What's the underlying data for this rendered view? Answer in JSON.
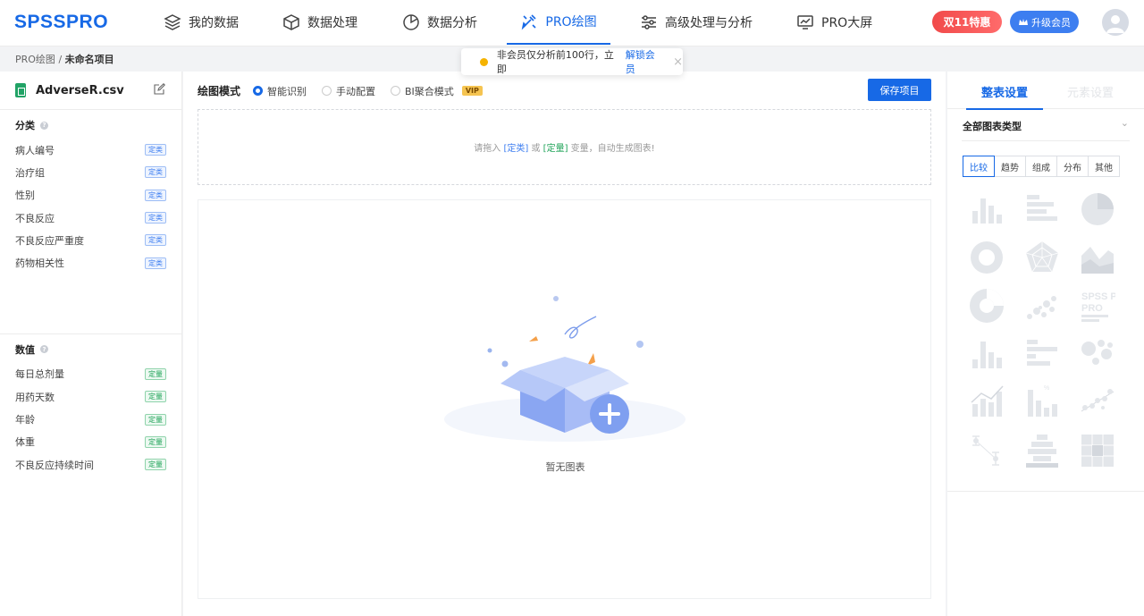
{
  "brand": {
    "logo": "SPSSPRO"
  },
  "nav": [
    {
      "label": "我的数据",
      "icon": "layers-icon",
      "active": false
    },
    {
      "label": "数据处理",
      "icon": "cube-icon",
      "active": false
    },
    {
      "label": "数据分析",
      "icon": "pie-icon",
      "active": false
    },
    {
      "label": "PRO绘图",
      "icon": "paint-icon",
      "active": true
    },
    {
      "label": "高级处理与分析",
      "icon": "sliders-icon",
      "active": false
    },
    {
      "label": "PRO大屏",
      "icon": "monitor-chart-icon",
      "active": false
    }
  ],
  "header": {
    "promo_label": "双11特惠",
    "upgrade_label": "升级会员",
    "avatar_icon": "user-avatar-icon"
  },
  "breadcrumb": {
    "parent": "PRO绘图",
    "sep": "/",
    "current": "未命名项目"
  },
  "toast": {
    "message": "非会员仅分析前100行，立即",
    "link": "解锁会员",
    "close": "×"
  },
  "left": {
    "file_name": "AdverseR.csv",
    "categorical": {
      "title": "分类",
      "help": "?",
      "tag": "定类",
      "items": [
        "病人编号",
        "治疗组",
        "性别",
        "不良反应",
        "不良反应严重度",
        "药物相关性"
      ]
    },
    "numeric": {
      "title": "数值",
      "help": "?",
      "tag": "定量",
      "items": [
        "每日总剂量",
        "用药天数",
        "年龄",
        "体重",
        "不良反应持续时间"
      ]
    }
  },
  "center": {
    "mode_title": "绘图模式",
    "modes": [
      {
        "label": "智能识别",
        "selected": true
      },
      {
        "label": "手动配置",
        "selected": false
      },
      {
        "label": "BI聚合模式",
        "selected": false
      }
    ],
    "vip_badge": "VIP",
    "save_label": "保存项目",
    "drop_hint": {
      "prefix": "请拖入",
      "cat": "[定类]",
      "or": "或",
      "num": "[定量]",
      "suffix": "变量，自动生成图表!"
    },
    "empty_label": "暂无图表"
  },
  "right": {
    "tabs": [
      "整表设置",
      "元素设置"
    ],
    "all_types": "全部图表类型",
    "categories": [
      "比较",
      "趋势",
      "组成",
      "分布",
      "其他"
    ],
    "selected_category": "比较",
    "chart_icons": [
      "bar-chart-icon",
      "horizontal-bar-icon",
      "pie-chart-icon",
      "donut-chart-icon",
      "radar-chart-icon",
      "area-chart-icon",
      "sunburst-chart-icon",
      "scatter-chart-icon",
      "wordcloud-icon",
      "histogram-icon",
      "horizontal-histogram-icon",
      "bubble-chart-icon",
      "bar-line-combo-icon",
      "percent-bar-icon",
      "scatter-fit-icon",
      "error-bar-icon",
      "funnel-bar-icon",
      "heatmap-icon"
    ],
    "wordcloud_text": "SPSS PRO"
  },
  "colors": {
    "primary": "#1769e6",
    "promo": "#f14a4a",
    "cat_tag": "#3d7ef0",
    "num_tag": "#22a45a",
    "icon_gray": "#e6e8eb"
  }
}
